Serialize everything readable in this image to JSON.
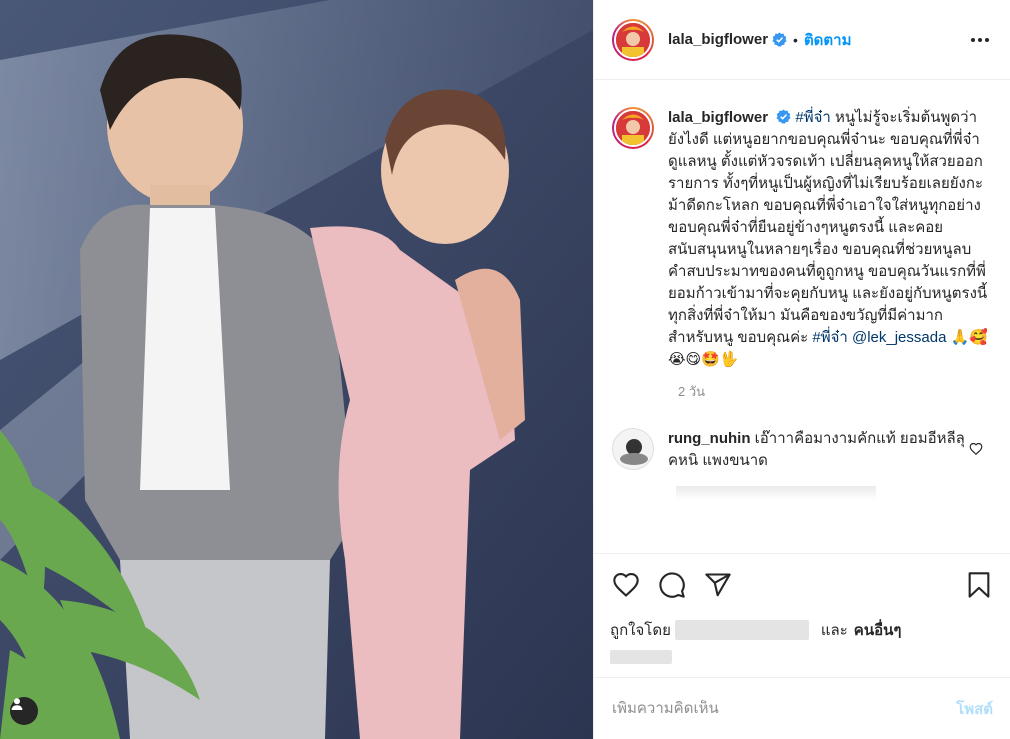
{
  "post": {
    "username": "lala_bigflower",
    "follow_label": "ติดตาม",
    "separator": "•",
    "more_icon": "more-horizontal-icon",
    "verified_icon": "verified-badge-icon"
  },
  "caption": {
    "username": "lala_bigflower",
    "hashtag_start": "#พี่จ๋า",
    "text": "หนูไม่รู้จะเริ่มต้นพูดว่ายังไงดี แต่หนูอยากขอบคุณพี่จ๋านะ ขอบคุณที่พี่จ๋าดูแลหนู ตั้งแต่หัวจรดเท้า เปลี่ยนลุคหนูให้สวยออกรายการ ทั้งๆที่หนูเป็นผู้หญิงที่ไม่เรียบร้อยเลยยังกะม้าดีดกะโหลก ขอบคุณที่พี่จ๋าเอาใจใส่หนูทุกอย่าง ขอบคุณพี่จ๋าที่ยืนอยู่ข้างๆหนูตรงนี้ และคอยสนับสนุนหนูในหลายๆเรื่อง ขอบคุณที่ช่วยหนูลบคำสบประมาทของคนที่ดูถูกหนู ขอบคุณวันแรกที่พี่ยอมก้าวเข้ามาที่จะคุยกับหนู และยังอยู่กับหนูตรงนี้ ทุกสิ่งที่พี่จ๋าให้มา มันคือของขวัญที่มีค่ามากสำหรับหนู ขอบคุณค่ะ",
    "hashtag_end": "#พี่จ๋า",
    "mention": "@lek_jessada",
    "emojis": "🙏🥰😭😋🤩🖖",
    "time_ago": "2 วัน"
  },
  "comment": {
    "username": "rung_nuhin",
    "text": "เอ๊าาาคือมางามคักแท้ ยอมอีหลีลุคหนิ แพงขนาด",
    "like_icon": "heart-outline-icon"
  },
  "actions": {
    "like_icon": "heart-icon",
    "comment_icon": "comment-icon",
    "share_icon": "paper-plane-icon",
    "save_icon": "bookmark-icon"
  },
  "likes": {
    "prefix": "ถูกใจโดย",
    "and": "และ",
    "others": "คนอื่นๆ"
  },
  "add_comment": {
    "placeholder": "เพิ่มความคิดเห็น",
    "post_label": "โพสต์"
  },
  "media": {
    "tag_icon": "user-tag-icon"
  }
}
